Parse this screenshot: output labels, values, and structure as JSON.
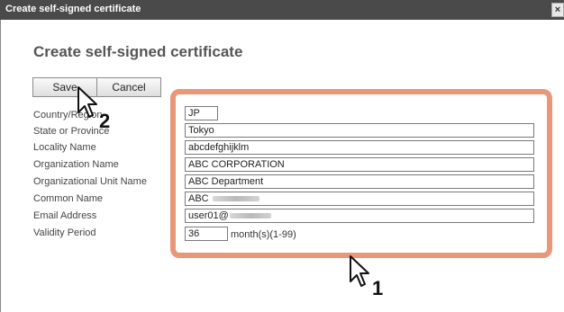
{
  "window": {
    "title": "Create self-signed certificate",
    "close_label": "×"
  },
  "page": {
    "heading": "Create self-signed certificate"
  },
  "buttons": {
    "save_label": "Save",
    "cancel_label": "Cancel"
  },
  "form": {
    "country_label": "Country/Region",
    "state_label": "State or Province",
    "locality_label": "Locality Name",
    "organization_label": "Organization Name",
    "org_unit_label": "Organizational Unit Name",
    "common_name_label": "Common Name",
    "email_label": "Email Address",
    "validity_label": "Validity Period",
    "country_value": "JP",
    "state_value": "Tokyo",
    "locality_value": "abcdefghijklm",
    "organization_value": "ABC CORPORATION",
    "org_unit_value": "ABC Department",
    "common_name_prefix": "ABC",
    "email_prefix": "user01@",
    "validity_value": "36",
    "validity_unit": "month(s)(1-99)"
  },
  "annotations": {
    "step1": "1",
    "step2": "2",
    "highlight_color": "#e8977a"
  }
}
